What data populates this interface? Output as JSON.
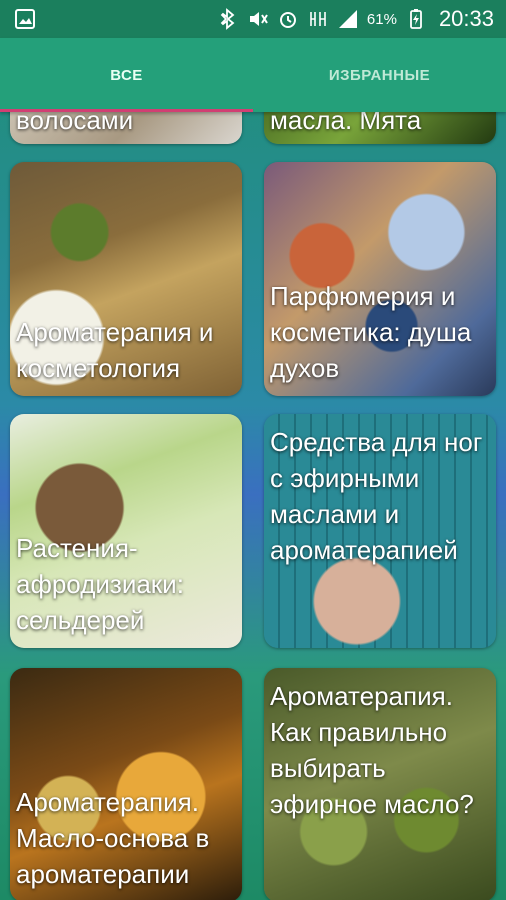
{
  "status_bar": {
    "battery_percent": "61%",
    "time": "20:33",
    "icons": [
      "gallery-icon",
      "bluetooth-icon",
      "mute-icon",
      "alarm-icon",
      "network-icon",
      "signal-icon",
      "battery-icon"
    ]
  },
  "tabs": [
    {
      "label": "ВСЕ",
      "active": true
    },
    {
      "label": "ИЗБРАННЫЕ",
      "active": false
    }
  ],
  "cards": [
    {
      "title": "волосами"
    },
    {
      "title": "масла. Мята"
    },
    {
      "title": "Ароматерапия и косметология"
    },
    {
      "title": "Парфюмерия и косметика: душа духов"
    },
    {
      "title": "Растения-афродизиаки: сельдерей"
    },
    {
      "title": "Средства для ног с эфирными маслами и ароматерапией"
    },
    {
      "title": "Ароматерапия. Масло-основа в ароматерапии"
    },
    {
      "title": "Ароматерапия. Как правильно выбирать эфирное масло?"
    }
  ],
  "colors": {
    "status_bar": "#1b7f5d",
    "tab_bar": "#24a07a",
    "tab_indicator": "#d13f73"
  }
}
